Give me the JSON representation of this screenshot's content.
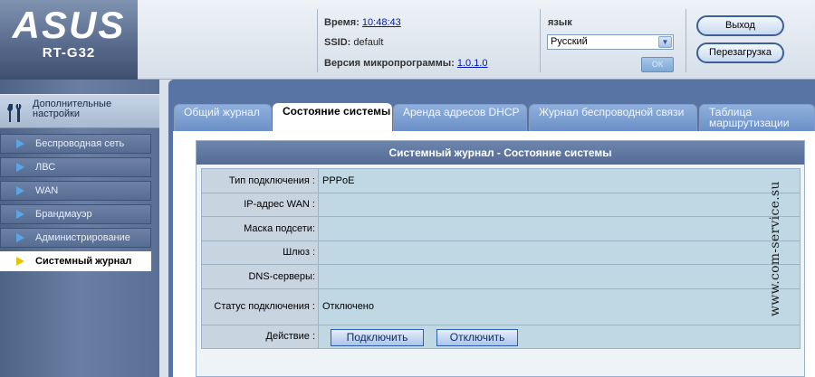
{
  "brand": {
    "logo": "ASUS",
    "model": "RT-G32"
  },
  "header": {
    "time_label": "Время:",
    "time_value": "10:48:43",
    "ssid_label": "SSID:",
    "ssid_value": "default",
    "firmware_label": "Версия микропрограммы:",
    "firmware_value": "1.0.1.0",
    "language_label": "язык",
    "language_value": "Русский",
    "ok_label": "ОК",
    "logout_label": "Выход",
    "reboot_label": "Перезагрузка"
  },
  "sidebar": {
    "header_label": "Дополнительные настройки",
    "items": [
      {
        "label": "Беспроводная сеть",
        "active": false
      },
      {
        "label": "ЛВС",
        "active": false
      },
      {
        "label": "WAN",
        "active": false
      },
      {
        "label": "Брандмауэр",
        "active": false
      },
      {
        "label": "Администрирование",
        "active": false
      },
      {
        "label": "Системный журнал",
        "active": true
      }
    ]
  },
  "tabs": [
    {
      "label": "Общий журнал"
    },
    {
      "label": "Состояние системы"
    },
    {
      "label": "Аренда адресов DHCP"
    },
    {
      "label": "Журнал беспроводной связи"
    },
    {
      "label": "Таблица маршрутизации"
    }
  ],
  "panel": {
    "title": "Системный журнал - Состояние системы",
    "rows": [
      {
        "label": "Тип подключения :",
        "value": "PPPoE"
      },
      {
        "label": "IP-адрес WAN :",
        "value": ""
      },
      {
        "label": "Маска подсети:",
        "value": ""
      },
      {
        "label": "Шлюз :",
        "value": ""
      },
      {
        "label": "DNS-серверы:",
        "value": ""
      },
      {
        "label": "Статус подключения :",
        "value": "Отключено"
      },
      {
        "label": "Действие :",
        "value": ""
      }
    ],
    "connect_label": "Подключить",
    "disconnect_label": "Отключить"
  },
  "watermark": "www.com-service.su",
  "colors": {
    "sidebar_bg": "#5a6f94",
    "panel_title_bg": "#536b95",
    "link": "#0018b4"
  }
}
